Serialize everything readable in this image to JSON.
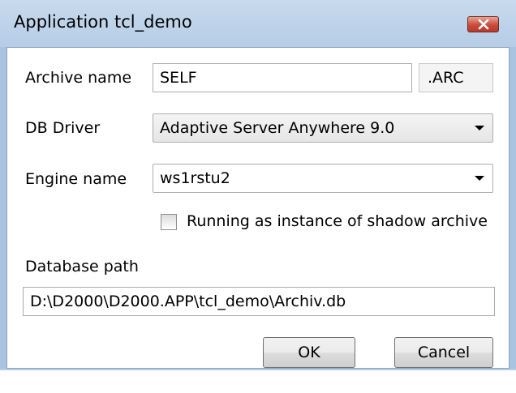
{
  "window": {
    "title": "Application tcl_demo"
  },
  "fields": {
    "archive_name_label": "Archive name",
    "archive_name_value": "SELF",
    "archive_extension": ".ARC",
    "db_driver_label": "DB Driver",
    "db_driver_value": "Adaptive Server Anywhere 9.0",
    "engine_name_label": "Engine name",
    "engine_name_value": "ws1rstu2",
    "shadow_checkbox_label": "Running as instance of shadow archive",
    "shadow_checkbox_checked": false,
    "database_path_label": "Database path",
    "database_path_value": "D:\\D2000\\D2000.APP\\tcl_demo\\Archiv.db"
  },
  "buttons": {
    "ok_label": "OK",
    "cancel_label": "Cancel"
  },
  "icons": {
    "close": "close-x-icon",
    "dropdown": "chevron-down-icon"
  },
  "colors": {
    "title_bar": "#b6cde6",
    "close_button": "#c94c3a"
  }
}
